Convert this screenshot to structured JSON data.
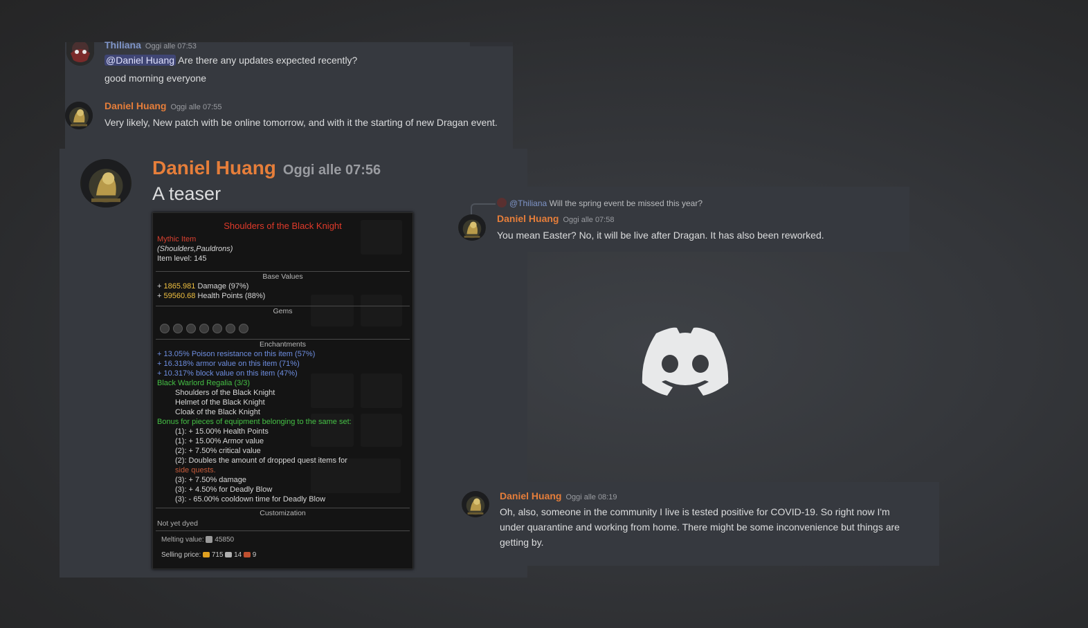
{
  "messages": {
    "thiliana_1": {
      "author": "Thiliana",
      "timestamp": "Oggi alle 07:53",
      "mention": "@Daniel Huang",
      "text": "Are there any updates expected recently?",
      "followup": "good morning everyone"
    },
    "daniel_1": {
      "author": "Daniel Huang",
      "timestamp": "Oggi alle 07:55",
      "text": "Very likely, New patch with be online tomorrow, and with it the starting of new Dragan event."
    },
    "daniel_2": {
      "author": "Daniel Huang",
      "timestamp": "Oggi alle 07:56",
      "text": "A teaser"
    },
    "daniel_3": {
      "reply_to": "@Thiliana",
      "reply_text": "Will the spring event be missed this year?",
      "author": "Daniel Huang",
      "timestamp": "Oggi alle 07:58",
      "text": "You mean Easter? No, it will be live after Dragan. It has also been reworked."
    },
    "daniel_4": {
      "author": "Daniel Huang",
      "timestamp": "Oggi alle 08:19",
      "text": "Oh, also, someone in the community I live is tested positive for COVID-19. So right now I'm under quarantine and working from home. There might be some inconvenience but things are getting by."
    }
  },
  "item": {
    "name": "Shoulders of the Black Knight",
    "rarity": "Mythic Item",
    "slot": "(Shoulders,Pauldrons)",
    "level": "Item level: 145",
    "base_header": "Base Values",
    "base": [
      {
        "value": "1865.981",
        "label": "Damage (97%)"
      },
      {
        "value": "59560.68",
        "label": "Health Points (88%)"
      }
    ],
    "gems_header": "Gems",
    "gem_count": 7,
    "ench_header": "Enchantments",
    "enchantments": [
      "+ 13.05% Poison resistance on this item (57%)",
      "+ 16.318% armor value on this item (71%)",
      "+ 10.317% block value on this item (47%)"
    ],
    "set_name": "Black Warlord Regalia (3/3)",
    "set_items": [
      "Shoulders of the Black Knight",
      "Helmet of the Black Knight",
      "Cloak of the Black Knight"
    ],
    "set_bonus_header": "Bonus for pieces of equipment belonging to the same set:",
    "set_bonuses": [
      "(1): + 15.00% Health Points",
      "(1): + 15.00% Armor value",
      "(2): + 7.50% critical value",
      "(2): Doubles the amount of dropped quest items for"
    ],
    "side_quests": "side quests.",
    "set_bonuses_2": [
      "(3): + 7.50% damage",
      "(3): + 4.50% for Deadly Blow",
      "(3): - 65.00% cooldown time for Deadly Blow"
    ],
    "custom_header": "Customization",
    "dye": "Not yet dyed",
    "melting": "Melting value:",
    "melting_value": "45850",
    "selling": "Selling price:",
    "selling_gold": "715",
    "selling_silver": "14",
    "selling_copper": "9"
  },
  "colors": {
    "username_orange": "#e67e3a",
    "username_blue": "#7f95c8",
    "panel_bg": "#36393f",
    "mention_bg": "#3f4574"
  },
  "icons": {
    "logo": "discord-logo-icon"
  }
}
